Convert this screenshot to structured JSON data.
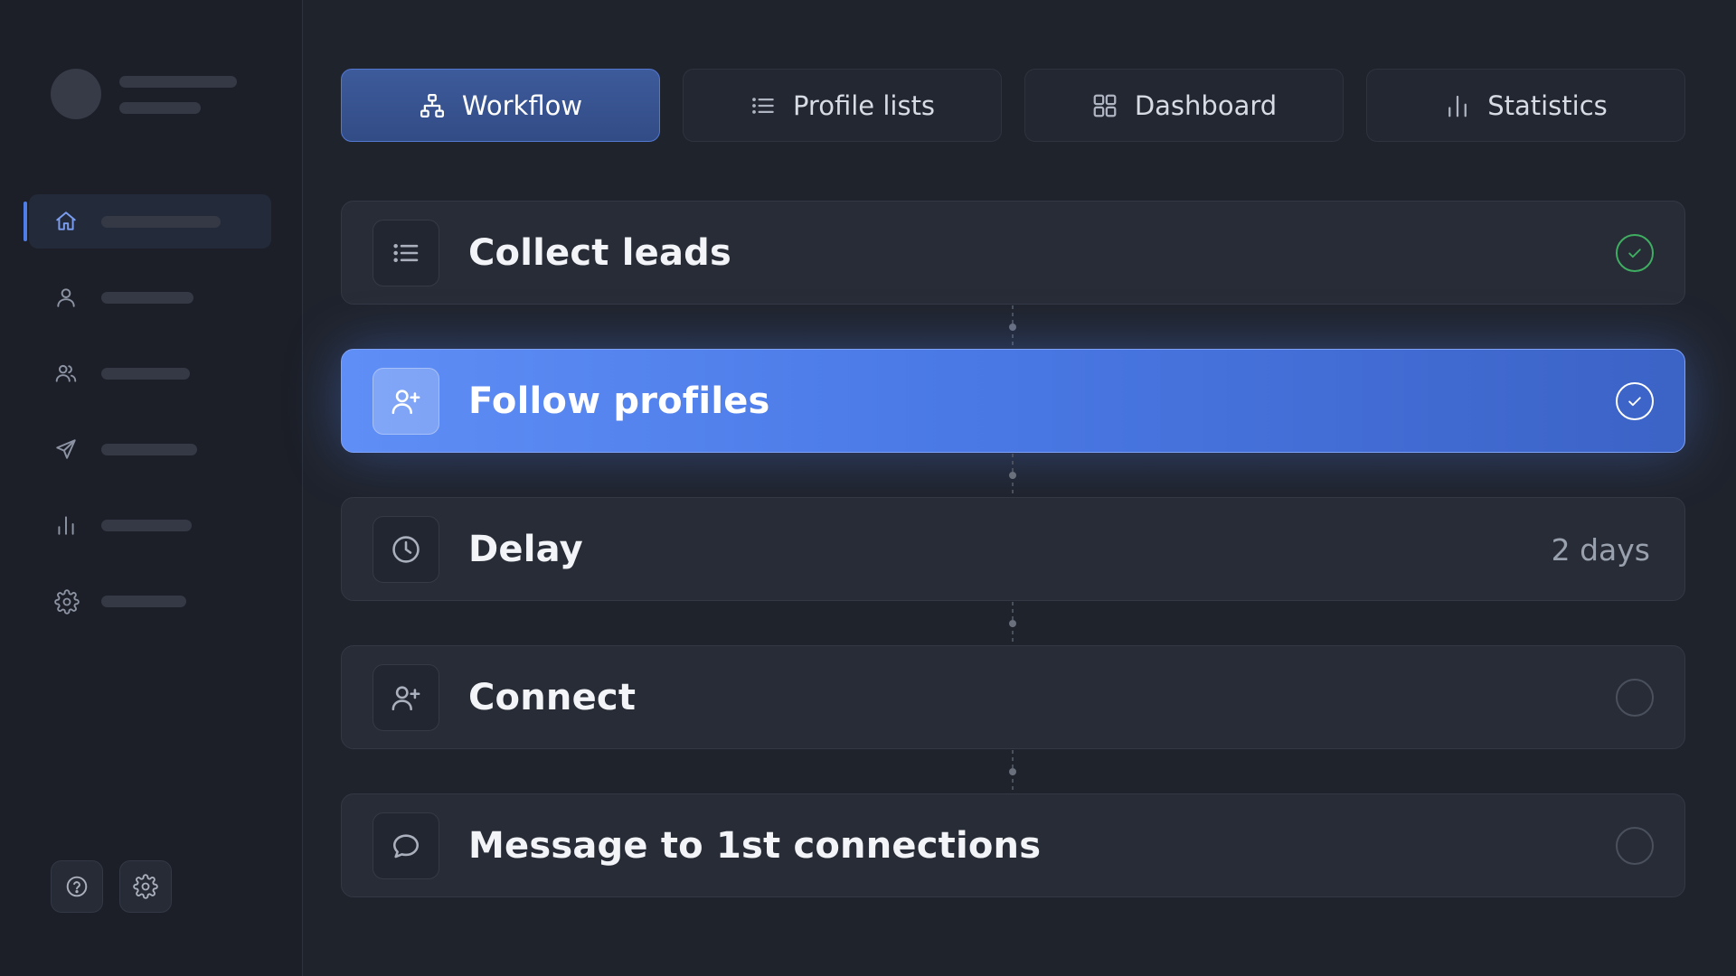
{
  "tabs": [
    {
      "label": "Workflow",
      "icon": "workflow-icon",
      "active": true
    },
    {
      "label": "Profile lists",
      "icon": "list-icon",
      "active": false
    },
    {
      "label": "Dashboard",
      "icon": "grid-icon",
      "active": false
    },
    {
      "label": "Statistics",
      "icon": "bar-chart-icon",
      "active": false
    }
  ],
  "steps": [
    {
      "title": "Collect leads",
      "icon": "list-icon",
      "status": "done"
    },
    {
      "title": "Follow profiles",
      "icon": "user-plus-icon",
      "status": "done",
      "active": true
    },
    {
      "title": "Delay",
      "icon": "clock-icon",
      "meta": "2 days"
    },
    {
      "title": "Connect",
      "icon": "user-plus-icon",
      "status": "pending"
    },
    {
      "title": "Message to 1st connections",
      "icon": "chat-bubble-icon",
      "status": "pending"
    }
  ],
  "sidebar": {
    "nav_icons": [
      "home-icon",
      "user-icon",
      "users-icon",
      "send-icon",
      "bar-chart-icon",
      "gear-icon"
    ],
    "active_index": 0,
    "bottom_icons": [
      "help-icon",
      "gear-icon"
    ]
  },
  "colors": {
    "accent": "#4f7de8",
    "success": "#3fae62",
    "background": "#1f232c"
  }
}
